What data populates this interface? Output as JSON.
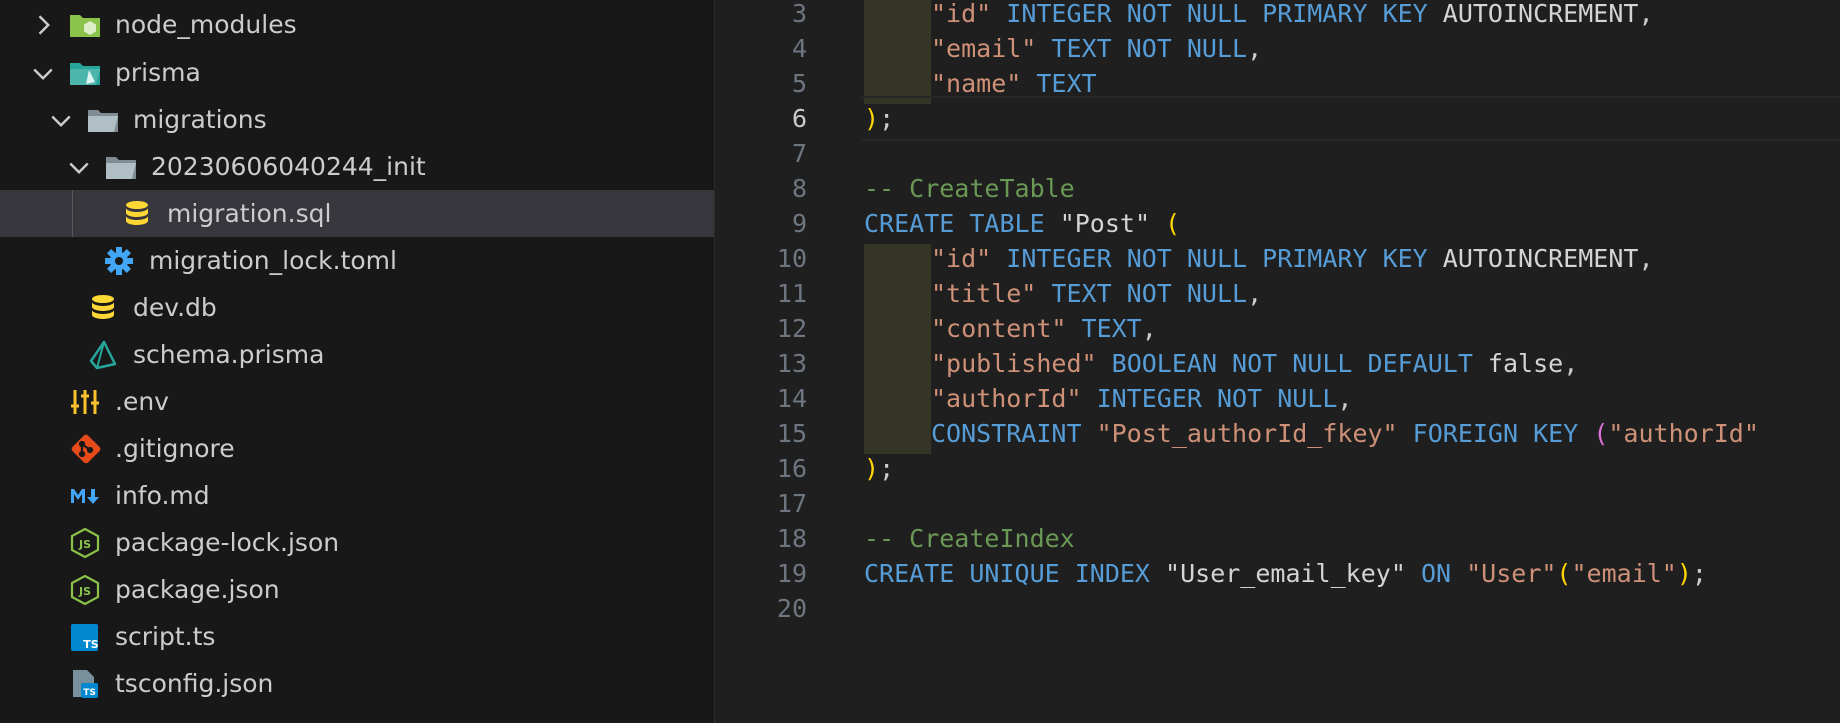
{
  "explorer": {
    "items": [
      {
        "label": "node_modules",
        "icon": "node-folder-icon",
        "chevron": "right"
      },
      {
        "label": "prisma",
        "icon": "prisma-folder-icon",
        "chevron": "down"
      },
      {
        "label": "migrations",
        "icon": "folder-open-icon",
        "chevron": "down"
      },
      {
        "label": "20230606040244_init",
        "icon": "folder-open-icon",
        "chevron": "down"
      },
      {
        "label": "migration.sql",
        "icon": "database-icon",
        "selected": true
      },
      {
        "label": "migration_lock.toml",
        "icon": "gear-icon"
      },
      {
        "label": "dev.db",
        "icon": "database-icon"
      },
      {
        "label": "schema.prisma",
        "icon": "prisma-icon"
      },
      {
        "label": ".env",
        "icon": "settings-sliders-icon"
      },
      {
        "label": ".gitignore",
        "icon": "git-icon"
      },
      {
        "label": "info.md",
        "icon": "markdown-icon"
      },
      {
        "label": "package-lock.json",
        "icon": "nodejs-icon"
      },
      {
        "label": "package.json",
        "icon": "nodejs-icon"
      },
      {
        "label": "script.ts",
        "icon": "typescript-icon"
      },
      {
        "label": "tsconfig.json",
        "icon": "tsconfig-icon"
      }
    ]
  },
  "editor": {
    "current_line": 6,
    "lines": [
      {
        "n": "3",
        "tokens": [
          {
            "t": "\"id\"",
            "c": "str"
          },
          {
            "t": " "
          },
          {
            "t": "INTEGER NOT NULL PRIMARY KEY",
            "c": "kw"
          },
          {
            "t": " AUTOINCREMENT",
            "c": "id"
          },
          {
            "t": ","
          }
        ],
        "indent": true
      },
      {
        "n": "4",
        "tokens": [
          {
            "t": "\"email\"",
            "c": "str"
          },
          {
            "t": " "
          },
          {
            "t": "TEXT NOT NULL",
            "c": "kw"
          },
          {
            "t": ","
          }
        ],
        "indent": true
      },
      {
        "n": "5",
        "tokens": [
          {
            "t": "\"name\"",
            "c": "str"
          },
          {
            "t": " "
          },
          {
            "t": "TEXT",
            "c": "kw"
          }
        ],
        "indent": true
      },
      {
        "n": "6",
        "tokens": [
          {
            "t": ")",
            "c": "b1"
          },
          {
            "t": ";"
          }
        ]
      },
      {
        "n": "7",
        "tokens": []
      },
      {
        "n": "8",
        "tokens": [
          {
            "t": "-- CreateTable",
            "c": "cm"
          }
        ]
      },
      {
        "n": "9",
        "tokens": [
          {
            "t": "CREATE TABLE",
            "c": "kw"
          },
          {
            "t": " "
          },
          {
            "t": "\"Post\"",
            "c": "id"
          },
          {
            "t": " "
          },
          {
            "t": "(",
            "c": "b1"
          }
        ]
      },
      {
        "n": "10",
        "tokens": [
          {
            "t": "\"id\"",
            "c": "str"
          },
          {
            "t": " "
          },
          {
            "t": "INTEGER NOT NULL PRIMARY KEY",
            "c": "kw"
          },
          {
            "t": " AUTOINCREMENT",
            "c": "id"
          },
          {
            "t": ","
          }
        ],
        "indent": true
      },
      {
        "n": "11",
        "tokens": [
          {
            "t": "\"title\"",
            "c": "str"
          },
          {
            "t": " "
          },
          {
            "t": "TEXT NOT NULL",
            "c": "kw"
          },
          {
            "t": ","
          }
        ],
        "indent": true
      },
      {
        "n": "12",
        "tokens": [
          {
            "t": "\"content\"",
            "c": "str"
          },
          {
            "t": " "
          },
          {
            "t": "TEXT",
            "c": "kw"
          },
          {
            "t": ","
          }
        ],
        "indent": true
      },
      {
        "n": "13",
        "tokens": [
          {
            "t": "\"published\"",
            "c": "str"
          },
          {
            "t": " "
          },
          {
            "t": "BOOLEAN NOT NULL DEFAULT",
            "c": "kw"
          },
          {
            "t": " false",
            "c": "id"
          },
          {
            "t": ","
          }
        ],
        "indent": true
      },
      {
        "n": "14",
        "tokens": [
          {
            "t": "\"authorId\"",
            "c": "str"
          },
          {
            "t": " "
          },
          {
            "t": "INTEGER NOT NULL",
            "c": "kw"
          },
          {
            "t": ","
          }
        ],
        "indent": true
      },
      {
        "n": "15",
        "tokens": [
          {
            "t": "CONSTRAINT",
            "c": "kw"
          },
          {
            "t": " "
          },
          {
            "t": "\"Post_authorId_fkey\"",
            "c": "str"
          },
          {
            "t": " "
          },
          {
            "t": "FOREIGN KEY",
            "c": "kw"
          },
          {
            "t": " "
          },
          {
            "t": "(",
            "c": "b2"
          },
          {
            "t": "\"authorId\"",
            "c": "str"
          }
        ],
        "indent": true
      },
      {
        "n": "16",
        "tokens": [
          {
            "t": ")",
            "c": "b1"
          },
          {
            "t": ";"
          }
        ]
      },
      {
        "n": "17",
        "tokens": []
      },
      {
        "n": "18",
        "tokens": [
          {
            "t": "-- CreateIndex",
            "c": "cm"
          }
        ]
      },
      {
        "n": "19",
        "tokens": [
          {
            "t": "CREATE UNIQUE INDEX",
            "c": "kw"
          },
          {
            "t": " "
          },
          {
            "t": "\"User_email_key\"",
            "c": "id"
          },
          {
            "t": " "
          },
          {
            "t": "ON",
            "c": "kw"
          },
          {
            "t": " "
          },
          {
            "t": "\"User\"",
            "c": "str"
          },
          {
            "t": "(",
            "c": "b1"
          },
          {
            "t": "\"email\"",
            "c": "str"
          },
          {
            "t": ")",
            "c": "b1"
          },
          {
            "t": ";"
          }
        ]
      },
      {
        "n": "20",
        "tokens": []
      }
    ]
  }
}
